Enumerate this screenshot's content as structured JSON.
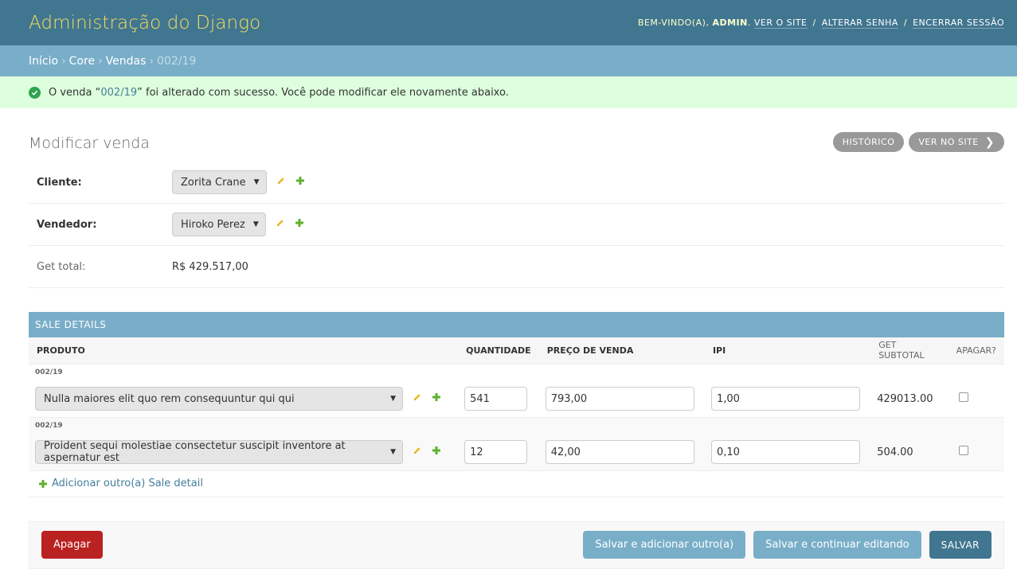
{
  "header": {
    "branding": "Administração do Django",
    "welcome": "Bem-vindo(a),",
    "username": "ADMIN",
    "view_site": "Ver o site",
    "change_password": "Alterar senha",
    "logout": "Encerrar sessão",
    "separator": "/"
  },
  "breadcrumbs": {
    "home": "Início",
    "app": "Core",
    "model": "Vendas",
    "current": "002/19",
    "separator": "›"
  },
  "message": {
    "prefix": "O venda “",
    "link": "002/19",
    "suffix": "” foi alterado com sucesso. Você pode modificar ele novamente abaixo."
  },
  "page": {
    "title": "Modificar venda",
    "history_button": "Histórico",
    "view_on_site_button": "Ver no site"
  },
  "form": {
    "cliente_label": "Cliente:",
    "cliente_value": "Zorita Crane",
    "vendedor_label": "Vendedor:",
    "vendedor_value": "Hiroko Perez",
    "total_label": "Get total:",
    "total_value": "R$ 429.517,00"
  },
  "inline": {
    "title": "Sale details",
    "headers": {
      "produto": "Produto",
      "quantidade": "Quantidade",
      "preco": "Preço de venda",
      "ipi": "IPI",
      "subtotal": "Get subtotal",
      "apagar": "Apagar?"
    },
    "rows": [
      {
        "original": "002/19",
        "produto": "Nulla maiores elit quo rem consequuntur qui qui",
        "quantidade": "541",
        "preco": "793,00",
        "ipi": "1,00",
        "subtotal": "429013.00"
      },
      {
        "original": "002/19",
        "produto": "Proident sequi molestiae consectetur suscipit inventore at aspernatur est",
        "quantidade": "12",
        "preco": "42,00",
        "ipi": "0,10",
        "subtotal": "504.00"
      }
    ],
    "add_another": "Adicionar outro(a) Sale detail"
  },
  "submit": {
    "delete": "Apagar",
    "save_add_another": "Salvar e adicionar outro(a)",
    "save_continue": "Salvar e continuar editando",
    "save": "Salvar"
  },
  "colors": {
    "header_bg": "#417690",
    "branding": "#f5dd5d",
    "breadcrumbs_bg": "#79aec8",
    "success_bg": "#ddffdd",
    "delete_bg": "#ba2121",
    "add_green": "#5fb12e",
    "pencil_yellow": "#e8b918"
  }
}
